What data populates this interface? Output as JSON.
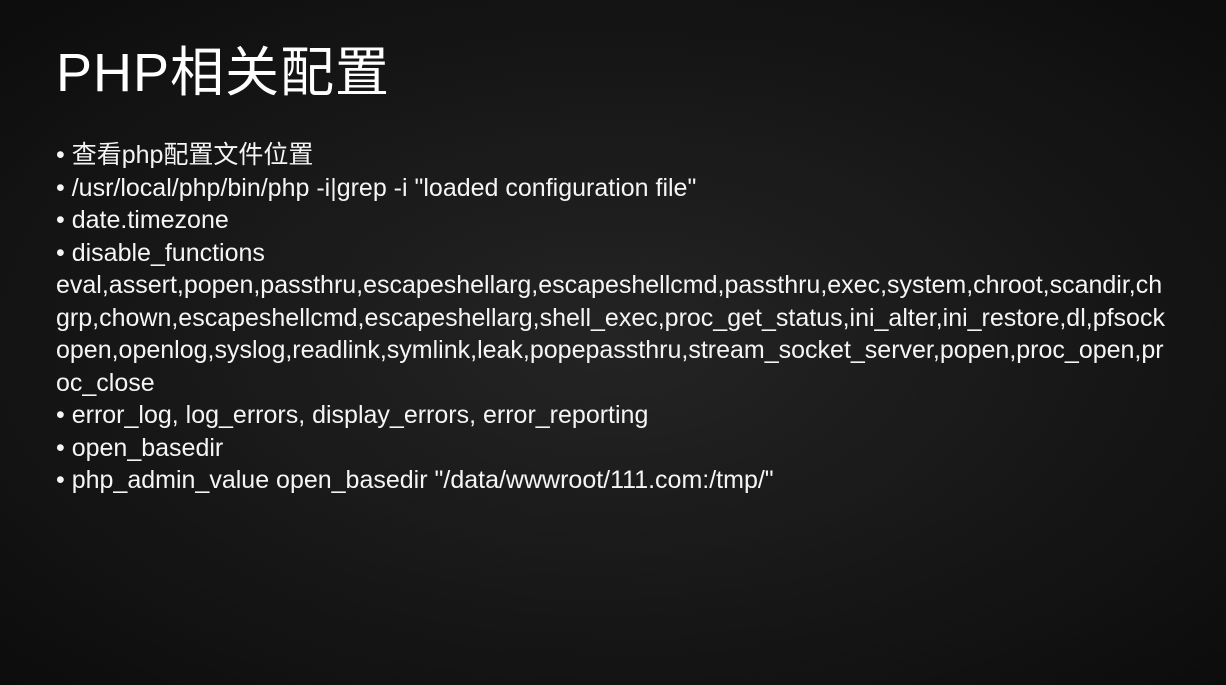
{
  "title": "PHP相关配置",
  "bullets": [
    "查看php配置文件位置",
    "/usr/local/php/bin/php -i|grep -i \"loaded configuration file\"",
    "date.timezone",
    "disable_functions"
  ],
  "functions_list": "eval,assert,popen,passthru,escapeshellarg,escapeshellcmd,passthru,exec,system,chroot,scandir,chgrp,chown,escapeshellcmd,escapeshellarg,shell_exec,proc_get_status,ini_alter,ini_restore,dl,pfsockopen,openlog,syslog,readlink,symlink,leak,popepassthru,stream_socket_server,popen,proc_open,proc_close",
  "bullets_after": [
    "error_log, log_errors, display_errors, error_reporting",
    "open_basedir",
    "php_admin_value open_basedir \"/data/wwwroot/111.com:/tmp/\""
  ],
  "bullet_char": "•"
}
